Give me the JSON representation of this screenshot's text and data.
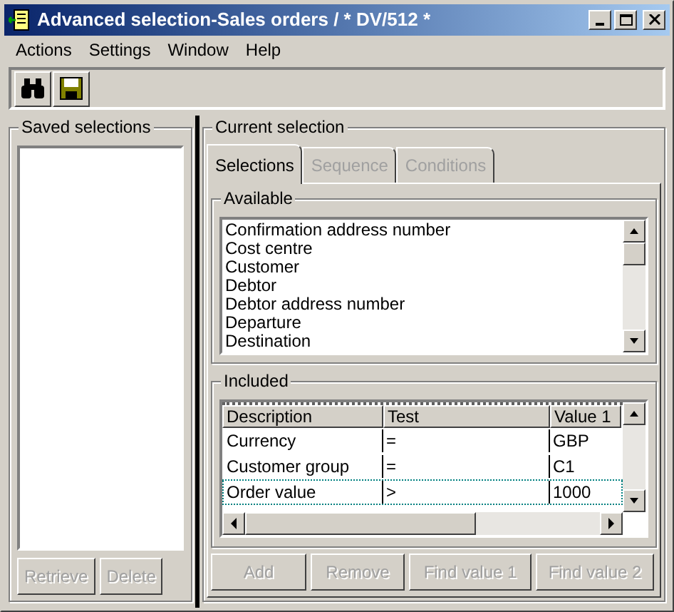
{
  "window": {
    "title": "Advanced selection-Sales orders / * DV/512 *"
  },
  "menu": [
    "Actions",
    "Settings",
    "Window",
    "Help"
  ],
  "saved_selections": {
    "title": "Saved selections",
    "buttons": [
      {
        "label": "Retrieve",
        "disabled": true
      },
      {
        "label": "Delete",
        "disabled": true
      }
    ]
  },
  "current_selection": {
    "title": "Current selection",
    "tabs": [
      {
        "label": "Selections",
        "selected": true,
        "disabled": false
      },
      {
        "label": "Sequence",
        "selected": false,
        "disabled": true
      },
      {
        "label": "Conditions",
        "selected": false,
        "disabled": true
      }
    ],
    "available": {
      "title": "Available",
      "items": [
        "Confirmation address number",
        "Cost centre",
        "Customer",
        "Debtor",
        "Debtor address number",
        "Departure",
        "Destination"
      ]
    },
    "included": {
      "title": "Included",
      "columns": [
        "Description",
        "Test",
        "Value 1"
      ],
      "rows": [
        {
          "cells": [
            "Currency",
            "=",
            "GBP"
          ],
          "focused": false
        },
        {
          "cells": [
            "Customer group",
            "=",
            "C1"
          ],
          "focused": false
        },
        {
          "cells": [
            "Order value",
            ">",
            "1000"
          ],
          "focused": true
        }
      ]
    },
    "buttons": [
      {
        "label": "Add",
        "disabled": true
      },
      {
        "label": "Remove",
        "disabled": true
      },
      {
        "label": "Find value 1",
        "disabled": true
      },
      {
        "label": "Find value 2",
        "disabled": true
      }
    ]
  }
}
